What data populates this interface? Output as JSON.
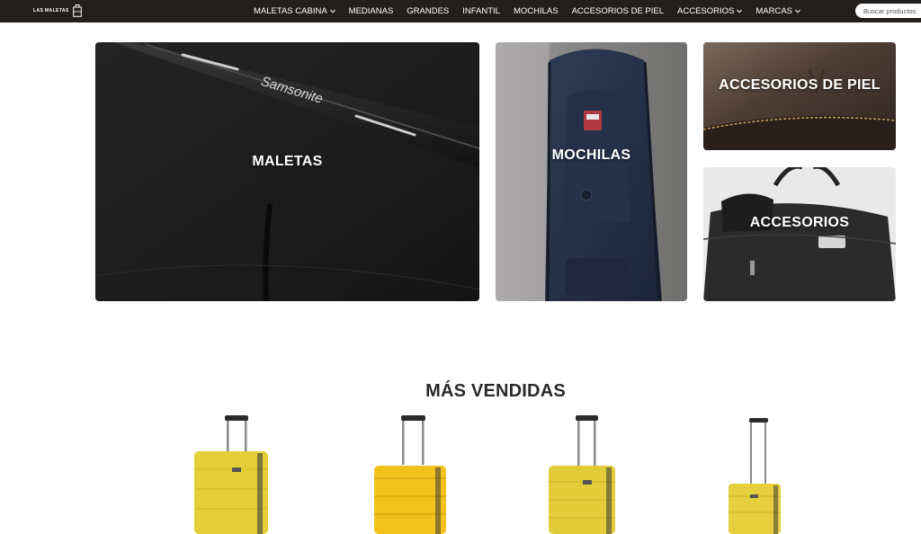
{
  "nav": {
    "logo_text": "LAS MALETAS",
    "items": [
      {
        "label": "MALETAS CABINA",
        "dropdown": true
      },
      {
        "label": "MEDIANAS",
        "dropdown": false
      },
      {
        "label": "GRANDES",
        "dropdown": false
      },
      {
        "label": "INFANTIL",
        "dropdown": false
      },
      {
        "label": "MOCHILAS",
        "dropdown": false
      },
      {
        "label": "ACCESORIOS DE PIEL",
        "dropdown": false
      },
      {
        "label": "ACCESORIOS",
        "dropdown": true
      },
      {
        "label": "MARCAS",
        "dropdown": true
      }
    ],
    "search_placeholder": "Buscar productos"
  },
  "categories": {
    "maletas": {
      "label": "MALETAS",
      "brand_mark": "Samsonite"
    },
    "mochilas": {
      "label": "MOCHILAS"
    },
    "piel": {
      "label": "ACCESORIOS DE PIEL"
    },
    "accesorios": {
      "label": "ACCESORIOS"
    }
  },
  "best_sellers": {
    "title": "MÁS VENDIDAS",
    "products": [
      {
        "icon": "yellow-suitcase-icon",
        "color": "#e5cf36"
      },
      {
        "icon": "yellow-suitcase-icon",
        "color": "#f2c21a"
      },
      {
        "icon": "yellow-suitcase-icon",
        "color": "#e3cc3a"
      },
      {
        "icon": "yellow-suitcase-icon",
        "color": "#e6cf3c"
      }
    ]
  },
  "colors": {
    "navbar": "#221f1c",
    "text_dark": "#2a2a2a"
  }
}
